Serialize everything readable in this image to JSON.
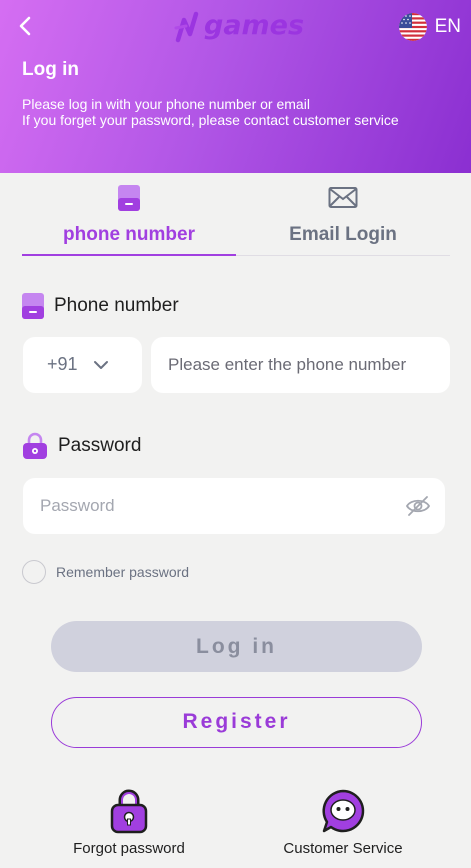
{
  "header": {
    "logo_text": "games",
    "language": "EN",
    "title": "Log in",
    "desc_line1": "Please log in with your phone number or email",
    "desc_line2": "If you forget your password, please contact customer service"
  },
  "tabs": [
    {
      "label": "phone number",
      "active": true
    },
    {
      "label": "Email Login",
      "active": false
    }
  ],
  "phone": {
    "label": "Phone number",
    "country_code": "+91",
    "placeholder": "Please enter the phone number"
  },
  "password": {
    "label": "Password",
    "placeholder": "Password"
  },
  "remember_label": "Remember password",
  "buttons": {
    "login": "Log in",
    "register": "Register"
  },
  "footer": {
    "forgot": "Forgot password",
    "support": "Customer Service"
  },
  "colors": {
    "accent": "#a13fe0",
    "header_start": "#d56ef2",
    "header_end": "#8b2fd1"
  }
}
